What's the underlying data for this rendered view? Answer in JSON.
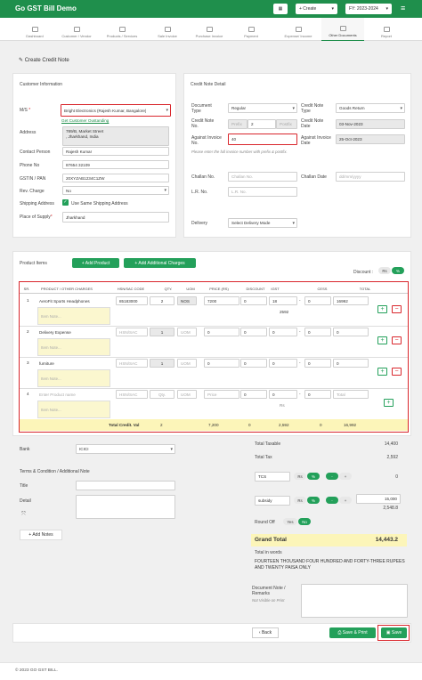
{
  "app": {
    "title": "Go GST Bill Demo",
    "create_label": "+ Create",
    "fy_label": "FY: 2023-2024"
  },
  "nav": [
    {
      "label": "Dashboard"
    },
    {
      "label": "Customer / Vendor"
    },
    {
      "label": "Products / Services"
    },
    {
      "label": "Sale Invoice"
    },
    {
      "label": "Purchase Invoice"
    },
    {
      "label": "Payment"
    },
    {
      "label": "Expense/ Income"
    },
    {
      "label": "Other Documents"
    },
    {
      "label": "Report"
    }
  ],
  "page": {
    "title": "Create Credit Note"
  },
  "customer": {
    "section": "Customer Information",
    "ms_label": "M/S",
    "ms_value": "Bright Electronics (Rajesh Kumar, Bangalore)",
    "outstanding": "Get Customer Oustanding",
    "address_label": "Address",
    "address_value": "789/B, Market Street\n, Jharkhand, India",
    "contact_label": "Contact Person",
    "contact_value": "Rajesh Kumar",
    "phone_label": "Phone No",
    "phone_value": "87654 32109",
    "gstin_label": "GSTIN / PAN",
    "gstin_value": "20XYZAB1234C1ZW",
    "rev_label": "Rev. Charge",
    "rev_value": "No",
    "ship_label": "Shipping Address",
    "ship_check": "Use Same Shipping Address",
    "pos_label": "Place of Supply",
    "pos_value": "Jharkhand"
  },
  "note_detail": {
    "section": "Credit Note Detail",
    "doc_type_label": "Document Type",
    "doc_type_value": "Regular",
    "cn_type_label": "Credit Note Type",
    "cn_type_value": "Goods Return",
    "cn_no_label": "Credit Note No.",
    "prefix_ph": "Prefix",
    "cn_no_value": "2",
    "postfix_ph": "Postfix",
    "cn_date_label": "Credit Note Date",
    "cn_date_value": "03-Nov-2023",
    "against_label": "Against Invoice No.",
    "against_value": "40",
    "against_date_label": "Against Invoice Date",
    "against_date_value": "25-Oct-2023",
    "hint": "Please enter the full invoice number with prefix & postfix.",
    "challan_label": "Challan No.",
    "challan_ph": "Challan No.",
    "challan_date_label": "Challan Date",
    "challan_date_ph": "dd/mm/yyyy",
    "lr_label": "L.R. No.",
    "lr_ph": "L.R. No.",
    "delivery_label": "Delivery",
    "delivery_value": "Select Delivery Mode"
  },
  "products": {
    "title": "Product Items",
    "add_product": "+ Add Product",
    "add_charges": "+ Add Additional Charges",
    "discount_label": "Discount :",
    "disc_rs": "Rs",
    "disc_pct": "%",
    "headers": [
      "SR.",
      "PRODUCT / OTHER CHARGES",
      "HSN/SAC CODE",
      "QTY.",
      "UOM",
      "PRICE (RS)",
      "DISCOUNT",
      "IGST",
      "CESS",
      "TOTAL"
    ],
    "rows": [
      {
        "sr": "1",
        "name": "AeroFit Sports Headphones",
        "note": "Item Note...",
        "hsn": "85183000",
        "qty": "2",
        "uom": "NOS",
        "price": "7200",
        "disc": "0",
        "igst": "18",
        "igst_amt": "2592",
        "cess": "0",
        "total": "16992"
      },
      {
        "sr": "2",
        "name": "Delivery Expense",
        "note": "Item Note...",
        "hsn": "HSN/SAC",
        "qty": "1",
        "uom": "UOM",
        "price": "0",
        "disc": "0",
        "igst": "0",
        "igst_amt": "",
        "cess": "0",
        "total": "0"
      },
      {
        "sr": "3",
        "name": "furniture",
        "note": "Item Note...",
        "hsn": "HSN/SAC",
        "qty": "1",
        "uom": "UOM",
        "price": "0",
        "disc": "0",
        "igst": "0",
        "igst_amt": "",
        "cess": "0",
        "total": "0"
      },
      {
        "sr": "4",
        "name": "Enter Product name",
        "note": "Item Note...",
        "hsn": "HSN/SAC",
        "qty": "Qty.",
        "uom": "UOM",
        "price": "Price",
        "disc": "0",
        "igst": "0",
        "igst_amt": "Rs",
        "cess": "0",
        "total": "Total"
      }
    ],
    "footer": {
      "label": "Total Credit. Val",
      "qty": "2",
      "price": "7,200",
      "disc": "0",
      "igst": "2,592",
      "cess": "0",
      "total": "16,992"
    }
  },
  "bank": {
    "label": "Bank",
    "value": "ICICI"
  },
  "terms": {
    "section": "Terms & Condition / Additional Note",
    "title_label": "Title",
    "detail_label": "Detail",
    "add_notes": "+ Add Notes"
  },
  "totals": {
    "taxable_label": "Total Taxable",
    "taxable": "14,400",
    "tax_label": "Total Tax",
    "tax": "2,592",
    "tcs_label": "TCS",
    "rs": "Rs",
    "pct": "%",
    "minus": "-",
    "plus": "+",
    "tcs_val": "0",
    "subsidy_label": "subsidy",
    "subsidy_val": "15,000",
    "subsidy_amt": "2,548.8",
    "roundoff_label": "Round Off",
    "yes": "Yes",
    "no": "No",
    "grand_label": "Grand Total",
    "grand": "14,443.2",
    "words_label": "Total in words",
    "words": "FOURTEEN THOUSAND FOUR HUNDRED AND FORTY-THREE RUPEES AND TWENTY PAISA ONLY",
    "remarks_label": "Document Note / Remarks",
    "remarks_sub": "Not Visible on Print"
  },
  "actions": {
    "back": "Back",
    "save_print": "Save & Print",
    "save": "Save"
  },
  "footer": "© 2023 GO GST BILL.",
  "colors": {
    "brand": "#1f8f4c",
    "highlight": "#d9262c",
    "total_row": "#fcf5b9"
  }
}
